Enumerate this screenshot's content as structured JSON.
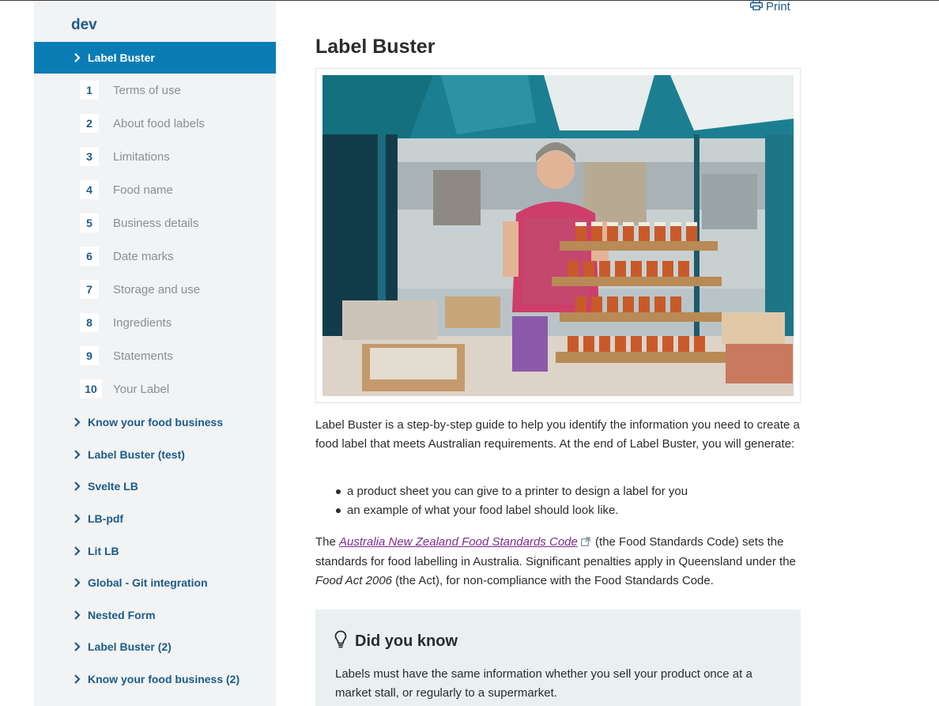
{
  "sidebar": {
    "title": "dev",
    "active_item": "Label Buster",
    "steps": [
      {
        "num": "1",
        "label": "Terms of use"
      },
      {
        "num": "2",
        "label": "About food labels"
      },
      {
        "num": "3",
        "label": "Limitations"
      },
      {
        "num": "4",
        "label": "Food name"
      },
      {
        "num": "5",
        "label": "Business details"
      },
      {
        "num": "6",
        "label": "Date marks"
      },
      {
        "num": "7",
        "label": "Storage and use"
      },
      {
        "num": "8",
        "label": "Ingredients"
      },
      {
        "num": "9",
        "label": "Statements"
      },
      {
        "num": "10",
        "label": "Your Label"
      }
    ],
    "groups": [
      "Know your food business",
      "Label Buster (test)",
      "Svelte LB",
      "LB-pdf",
      "Lit LB",
      "Global - Git integration",
      "Nested Form",
      "Label Buster (2)",
      "Know your food business (2)"
    ]
  },
  "main": {
    "print_label": "Print",
    "title": "Label Buster",
    "intro": "Label Buster is a step-by-step guide to help you identify the information you need to create a food label that meets Australian requirements. At the end of Label Buster, you will generate:",
    "bullets": [
      "a product sheet you can give to a printer to design a label for you",
      "an example of what your food label should look like."
    ],
    "para2_prefix": "The ",
    "para2_link": "Australia New Zealand Food Standards Code",
    "para2_mid": " (the Food Standards Code) sets the standards for food labelling in Australia. Significant penalties apply in Queensland under the ",
    "para2_act": "Food Act 2006",
    "para2_suffix": " (the Act), for non-compliance with the Food Standards Code.",
    "callout": {
      "title": "Did you know",
      "body": "Labels must have the same information whether you sell your product once at a market stall, or regularly to a supermarket."
    }
  },
  "colors": {
    "brand_blue": "#0a7cb5",
    "nav_text": "#1c5b8a",
    "link_visited": "#7c2d8c",
    "callout_bg": "#eaf0f2",
    "sidebar_bg": "#f1f3f4"
  },
  "icons": {
    "print": "printer-icon",
    "chevron": "chevron-right-icon",
    "external": "external-link-icon",
    "tip": "lightbulb-icon"
  }
}
